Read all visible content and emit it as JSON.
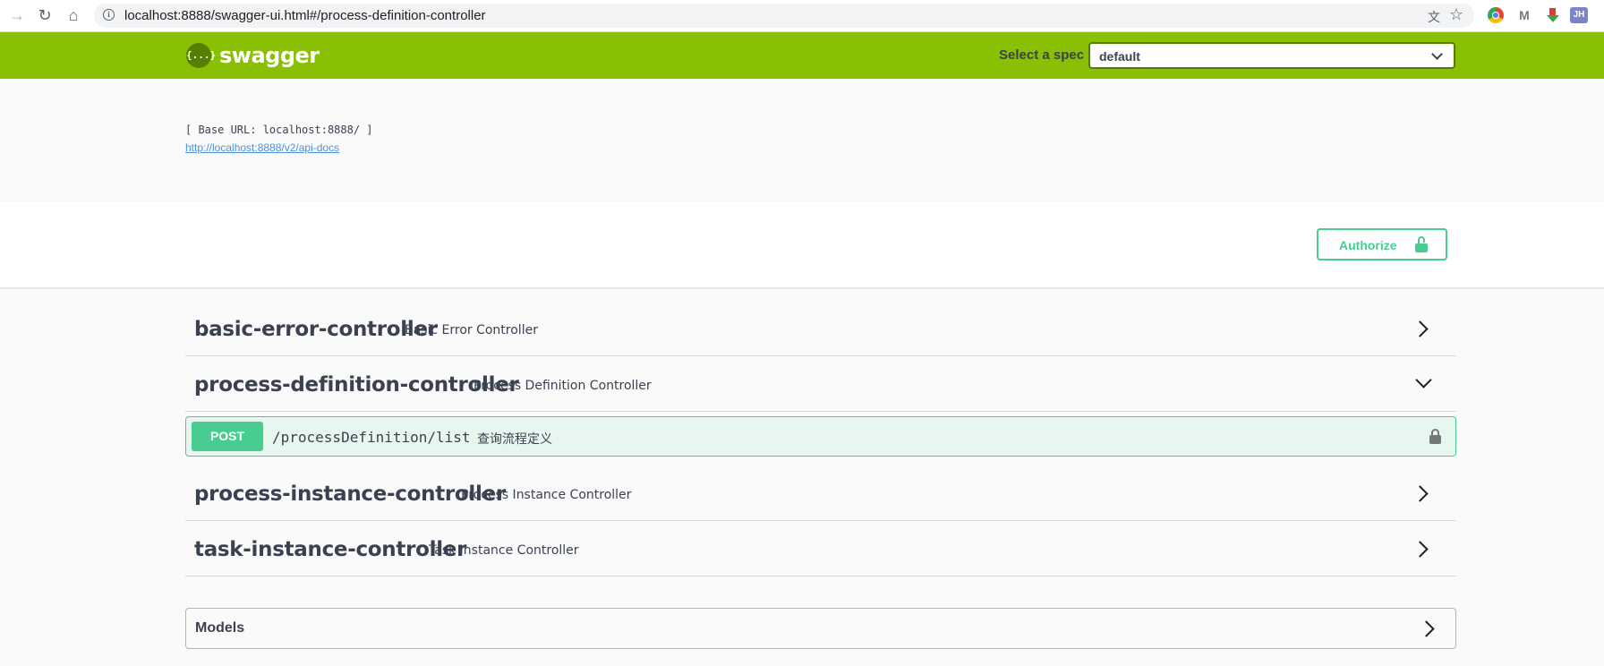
{
  "browser": {
    "url": "localhost:8888/swagger-ui.html#/process-definition-controller",
    "ext_jh_label": "JH",
    "ext_mail_label": "M"
  },
  "topbar": {
    "logo_mark": "{...}",
    "logo_text": "swagger",
    "spec_label": "Select a spec",
    "spec_selected": "default"
  },
  "info": {
    "base_url": "[ Base URL: localhost:8888/ ]",
    "api_docs_link": "http://localhost:8888/v2/api-docs"
  },
  "scheme": {
    "authorize_label": "Authorize"
  },
  "tags": [
    {
      "name": "basic-error-controller",
      "description": "Basic Error Controller",
      "expanded": false
    },
    {
      "name": "process-definition-controller",
      "description": "Process Definition Controller",
      "expanded": true
    },
    {
      "name": "process-instance-controller",
      "description": "Process Instance Controller",
      "expanded": false
    },
    {
      "name": "task-instance-controller",
      "description": "Task Instance Controller",
      "expanded": false
    }
  ],
  "operation": {
    "method": "POST",
    "path": "/processDefinition/list",
    "summary": "查询流程定义"
  },
  "models": {
    "label": "Models"
  },
  "colors": {
    "topbar": "#89bf04",
    "post": "#49cc90",
    "post_bg": "#e8f6f0",
    "text": "#3b4151"
  }
}
